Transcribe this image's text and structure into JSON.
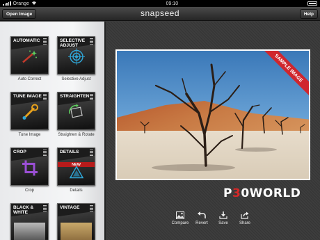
{
  "status": {
    "carrier": "Orange",
    "time": "09:10"
  },
  "nav": {
    "open_label": "Open Image",
    "title": "snapseed",
    "help_label": "Help"
  },
  "tools": [
    {
      "tile": "AUTOMATIC",
      "label": "Auto Correct",
      "icon": "wand-icon"
    },
    {
      "tile": "SELECTIVE ADJUST",
      "label": "Selective Adjust",
      "icon": "target-icon"
    },
    {
      "tile": "TUNE IMAGE",
      "label": "Tune Image",
      "icon": "wrench-icon"
    },
    {
      "tile": "STRAIGHTEN",
      "label": "Straighten & Rotate",
      "icon": "rotate-icon"
    },
    {
      "tile": "CROP",
      "label": "Crop",
      "icon": "crop-icon"
    },
    {
      "tile": "DETAILS",
      "label": "Details",
      "icon": "triangle-icon",
      "badge": "NEW"
    },
    {
      "tile": "BLACK & WHITE",
      "label": "",
      "icon": ""
    },
    {
      "tile": "VINTAGE",
      "label": "",
      "icon": ""
    }
  ],
  "photo": {
    "ribbon": "SAMPLE IMAGE"
  },
  "watermark": {
    "prefix": "P",
    "zero": "3",
    "suffix": "0WORLD"
  },
  "bottom": {
    "compare": "Compare",
    "revert": "Revert",
    "save": "Save",
    "share": "Share"
  },
  "colors": {
    "ribbon": "#d0262d",
    "badge": "#b71b1b",
    "crop_accent": "#9b4fd6",
    "tune_accent": "#e8a21c"
  }
}
